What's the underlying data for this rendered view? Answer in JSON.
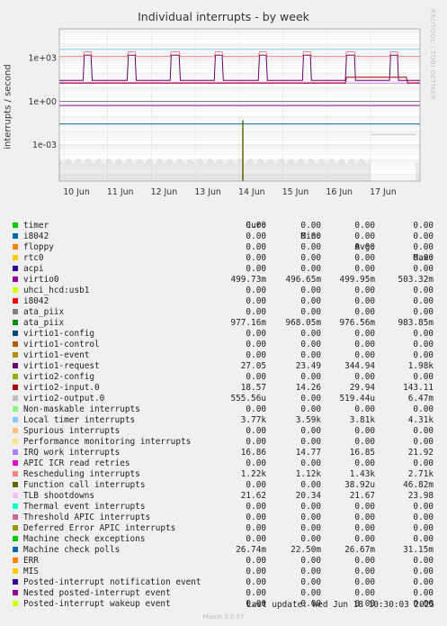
{
  "title": "Individual interrupts - by week",
  "ylabel": "interrupts / second",
  "brand": "RRDTOOL / TOBI OETIKER",
  "colors": {
    "background": "#f0f0f0",
    "plot": "#ffffff",
    "grid": "#e0c8c8"
  },
  "chart_data": {
    "type": "line",
    "y_scale": "log",
    "ylim": [
      3e-06,
      100000.0
    ],
    "y_ticks": [
      {
        "label": "1e+03",
        "value": 1000
      },
      {
        "label": "1e+00",
        "value": 1
      },
      {
        "label": "1e-03",
        "value": 0.001
      }
    ],
    "x_ticks": [
      "10 Jun",
      "11 Jun",
      "12 Jun",
      "13 Jun",
      "14 Jun",
      "15 Jun",
      "16 Jun",
      "17 Jun"
    ],
    "grid": true,
    "legend_columns": [
      "Cur:",
      "Min:",
      "Avg:",
      "Max:"
    ],
    "series": [
      {
        "name": "timer",
        "color": "#00cc00",
        "cur": "0.00",
        "min": "0.00",
        "avg": "0.00",
        "max": "0.00"
      },
      {
        "name": "i8042",
        "color": "#0066b3",
        "cur": "0.00",
        "min": "0.00",
        "avg": "0.00",
        "max": "0.00"
      },
      {
        "name": "floppy",
        "color": "#ff8000",
        "cur": "0.00",
        "min": "0.00",
        "avg": "0.00",
        "max": "0.00"
      },
      {
        "name": "rtc0",
        "color": "#ffcc00",
        "cur": "0.00",
        "min": "0.00",
        "avg": "0.00",
        "max": "0.00"
      },
      {
        "name": "acpi",
        "color": "#330099",
        "cur": "0.00",
        "min": "0.00",
        "avg": "0.00",
        "max": "0.00"
      },
      {
        "name": "virtio0",
        "color": "#990099",
        "cur": "499.73m",
        "min": "496.65m",
        "avg": "499.95m",
        "max": "503.32m"
      },
      {
        "name": "uhci_hcd:usb1",
        "color": "#ccff00",
        "cur": "0.00",
        "min": "0.00",
        "avg": "0.00",
        "max": "0.00"
      },
      {
        "name": "i8042",
        "color": "#ff0000",
        "cur": "0.00",
        "min": "0.00",
        "avg": "0.00",
        "max": "0.00"
      },
      {
        "name": "ata_piix",
        "color": "#808080",
        "cur": "0.00",
        "min": "0.00",
        "avg": "0.00",
        "max": "0.00"
      },
      {
        "name": "ata_piix",
        "color": "#008f00",
        "cur": "977.16m",
        "min": "968.05m",
        "avg": "976.56m",
        "max": "983.85m"
      },
      {
        "name": "virtio1-config",
        "color": "#00487d",
        "cur": "0.00",
        "min": "0.00",
        "avg": "0.00",
        "max": "0.00"
      },
      {
        "name": "virtio1-control",
        "color": "#b35a00",
        "cur": "0.00",
        "min": "0.00",
        "avg": "0.00",
        "max": "0.00"
      },
      {
        "name": "virtio1-event",
        "color": "#b38f00",
        "cur": "0.00",
        "min": "0.00",
        "avg": "0.00",
        "max": "0.00"
      },
      {
        "name": "virtio1-request",
        "color": "#6b006b",
        "cur": "27.05",
        "min": "23.49",
        "avg": "344.94",
        "max": "1.98k"
      },
      {
        "name": "virtio2-config",
        "color": "#8fb300",
        "cur": "0.00",
        "min": "0.00",
        "avg": "0.00",
        "max": "0.00"
      },
      {
        "name": "virtio2-input.0",
        "color": "#b30000",
        "cur": "18.57",
        "min": "14.26",
        "avg": "29.94",
        "max": "143.11"
      },
      {
        "name": "virtio2-output.0",
        "color": "#bebebe",
        "cur": "555.56u",
        "min": "0.00",
        "avg": "519.44u",
        "max": "6.47m"
      },
      {
        "name": "Non-maskable interrupts",
        "color": "#80ff80",
        "cur": "0.00",
        "min": "0.00",
        "avg": "0.00",
        "max": "0.00"
      },
      {
        "name": "Local timer interrupts",
        "color": "#80c9ff",
        "cur": "3.77k",
        "min": "3.59k",
        "avg": "3.81k",
        "max": "4.31k"
      },
      {
        "name": "Spurious interrupts",
        "color": "#ffc080",
        "cur": "0.00",
        "min": "0.00",
        "avg": "0.00",
        "max": "0.00"
      },
      {
        "name": "Performance monitoring interrupts",
        "color": "#ffe680",
        "cur": "0.00",
        "min": "0.00",
        "avg": "0.00",
        "max": "0.00"
      },
      {
        "name": "IRQ work interrupts",
        "color": "#aa80ff",
        "cur": "16.86",
        "min": "14.77",
        "avg": "16.85",
        "max": "21.92"
      },
      {
        "name": "APIC ICR read retries",
        "color": "#ee00cc",
        "cur": "0.00",
        "min": "0.00",
        "avg": "0.00",
        "max": "0.00"
      },
      {
        "name": "Rescheduling interrupts",
        "color": "#ff8080",
        "cur": "1.22k",
        "min": "1.12k",
        "avg": "1.43k",
        "max": "2.71k"
      },
      {
        "name": "Function call interrupts",
        "color": "#666600",
        "cur": "0.00",
        "min": "0.00",
        "avg": "38.92u",
        "max": "46.82m"
      },
      {
        "name": "TLB shootdowns",
        "color": "#ffbfff",
        "cur": "21.62",
        "min": "20.34",
        "avg": "21.67",
        "max": "23.98"
      },
      {
        "name": "Thermal event interrupts",
        "color": "#00ffcc",
        "cur": "0.00",
        "min": "0.00",
        "avg": "0.00",
        "max": "0.00"
      },
      {
        "name": "Threshold APIC interrupts",
        "color": "#cc6699",
        "cur": "0.00",
        "min": "0.00",
        "avg": "0.00",
        "max": "0.00"
      },
      {
        "name": "Deferred Error APIC interrupts",
        "color": "#999900",
        "cur": "0.00",
        "min": "0.00",
        "avg": "0.00",
        "max": "0.00"
      },
      {
        "name": "Machine check exceptions",
        "color": "#00cc00",
        "cur": "0.00",
        "min": "0.00",
        "avg": "0.00",
        "max": "0.00"
      },
      {
        "name": "Machine check polls",
        "color": "#0066b3",
        "cur": "26.74m",
        "min": "22.50m",
        "avg": "26.67m",
        "max": "31.15m"
      },
      {
        "name": "ERR",
        "color": "#ff8000",
        "cur": "0.00",
        "min": "0.00",
        "avg": "0.00",
        "max": "0.00"
      },
      {
        "name": "MIS",
        "color": "#ffcc00",
        "cur": "0.00",
        "min": "0.00",
        "avg": "0.00",
        "max": "0.00"
      },
      {
        "name": "Posted-interrupt notification event",
        "color": "#330099",
        "cur": "0.00",
        "min": "0.00",
        "avg": "0.00",
        "max": "0.00"
      },
      {
        "name": "Nested posted-interrupt event",
        "color": "#990099",
        "cur": "0.00",
        "min": "0.00",
        "avg": "0.00",
        "max": "0.00"
      },
      {
        "name": "Posted-interrupt wakeup event",
        "color": "#ccff00",
        "cur": "0.00",
        "min": "0.00",
        "avg": "0.00",
        "max": "0.00"
      }
    ]
  },
  "footer": "Last update: Wed Jun 18 10:30:03 2025",
  "munin": "Munin 2.0.57"
}
